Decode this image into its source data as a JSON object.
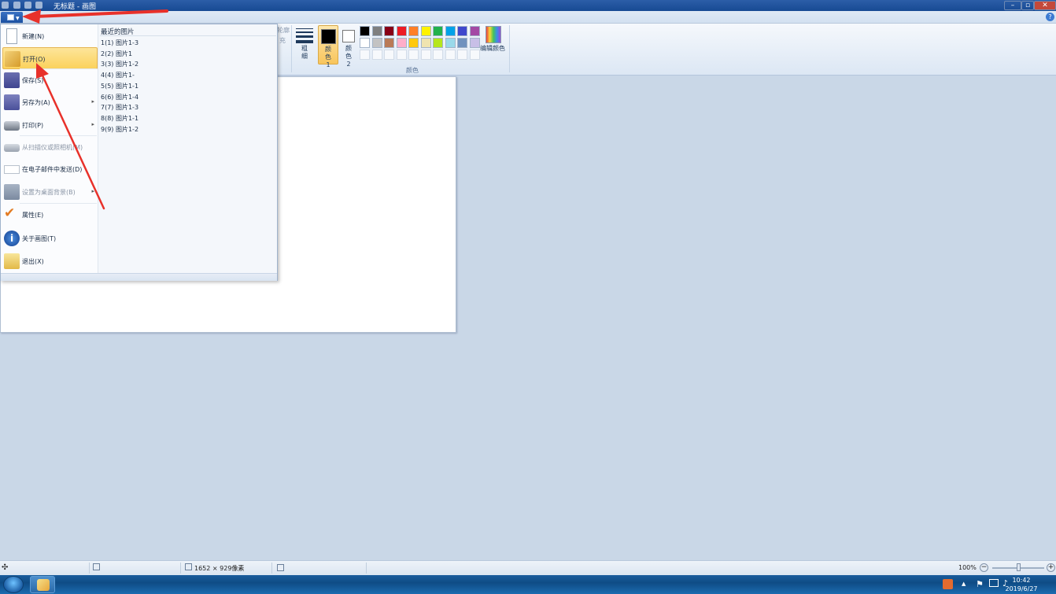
{
  "window": {
    "title": "无标题 - 画图",
    "minimize_label": "–",
    "maximize_label": "▫",
    "close_label": "✕"
  },
  "ribbon": {
    "hidden_fill_label_1": "轮廓",
    "hidden_fill_label_2": "充",
    "size_label": "粗细",
    "color1_label": "颜色 1",
    "color2_label": "颜色 2",
    "edit_colors_label": "编辑颜色",
    "colors_group_label": "颜色",
    "help_icon": "?",
    "color1_value": "#000000",
    "color2_value": "#ffffff",
    "palette_row1": [
      "#000000",
      "#7f7f7f",
      "#880015",
      "#ed1c24",
      "#ff7f27",
      "#fff200",
      "#22b14c",
      "#00a2e8",
      "#3f48cc",
      "#a349a4"
    ],
    "palette_row2": [
      "#ffffff",
      "#c3c3c3",
      "#b97a57",
      "#ffaec9",
      "#ffc90e",
      "#efe4b0",
      "#b5e61d",
      "#99d9ea",
      "#7092be",
      "#c8bfe7"
    ]
  },
  "file_menu": {
    "items": [
      {
        "label": "新建(N)",
        "icon": "new-file-icon",
        "disabled": false,
        "submenu": false
      },
      {
        "label": "打开(O)",
        "icon": "open-folder-icon",
        "disabled": false,
        "submenu": false
      },
      {
        "label": "保存(S)",
        "icon": "save-disk-icon",
        "disabled": false,
        "submenu": false
      },
      {
        "label": "另存为(A)",
        "icon": "save-as-icon",
        "disabled": false,
        "submenu": true
      },
      {
        "label": "打印(P)",
        "icon": "printer-icon",
        "disabled": false,
        "submenu": true
      },
      {
        "label": "从扫描仪或照相机(M)",
        "icon": "scanner-icon",
        "disabled": true,
        "submenu": false
      },
      {
        "label": "在电子邮件中发送(D)",
        "icon": "email-icon",
        "disabled": false,
        "submenu": false
      },
      {
        "label": "设置为桌面背景(B)",
        "icon": "desktop-background-icon",
        "disabled": true,
        "submenu": true
      },
      {
        "label": "属性(E)",
        "icon": "checkmark-icon",
        "disabled": false,
        "submenu": false
      },
      {
        "label": "关于画图(T)",
        "icon": "info-icon",
        "disabled": false,
        "submenu": false
      },
      {
        "label": "退出(X)",
        "icon": "exit-icon",
        "disabled": false,
        "submenu": false
      }
    ],
    "highlighted_index": 1,
    "recent_header": "最近的图片",
    "recent": [
      "1(1) 图片1-3",
      "2(2) 图片1",
      "3(3) 图片1-2",
      "4(4) 图片1-",
      "5(5) 图片1-1",
      "6(6) 图片1-4",
      "7(7) 图片1-3",
      "8(8) 图片1-1",
      "9(9) 图片1-2"
    ]
  },
  "statusbar": {
    "dimensions": "1652 × 929像素",
    "zoom": "100%",
    "zoom_fraction": 0.5
  },
  "taskbar": {
    "time": "10:42",
    "date": "2019/6/27",
    "tray_expand": "▲"
  },
  "annotation_color": "#e8312a"
}
